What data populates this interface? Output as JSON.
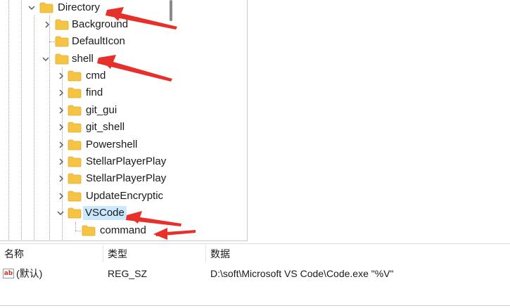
{
  "tree": {
    "nodes": [
      {
        "label": "Directory",
        "expanded": true
      },
      {
        "label": "Background",
        "expanded": false
      },
      {
        "label": "DefaultIcon"
      },
      {
        "label": "shell",
        "expanded": true
      },
      {
        "label": "cmd",
        "expanded": false
      },
      {
        "label": "find",
        "expanded": false
      },
      {
        "label": "git_gui",
        "expanded": false
      },
      {
        "label": "git_shell",
        "expanded": false
      },
      {
        "label": "Powershell",
        "expanded": false
      },
      {
        "label": "StellarPlayerPlay",
        "expanded": false
      },
      {
        "label": "StellarPlayerPlay",
        "expanded": false
      },
      {
        "label": "UpdateEncryptic",
        "expanded": false
      },
      {
        "label": "VSCode",
        "expanded": true,
        "selected": true
      },
      {
        "label": "command"
      }
    ]
  },
  "values": {
    "headers": {
      "name": "名称",
      "type": "类型",
      "data": "数据"
    },
    "rows": [
      {
        "name": "(默认)",
        "type": "REG_SZ",
        "data": "D:\\soft\\Microsoft VS Code\\Code.exe \"%V\"",
        "icon": "string-value-icon"
      }
    ]
  },
  "colors": {
    "folder": "#f6c443",
    "selection": "#cce8ff",
    "annotation_arrow": "#e8302a"
  }
}
